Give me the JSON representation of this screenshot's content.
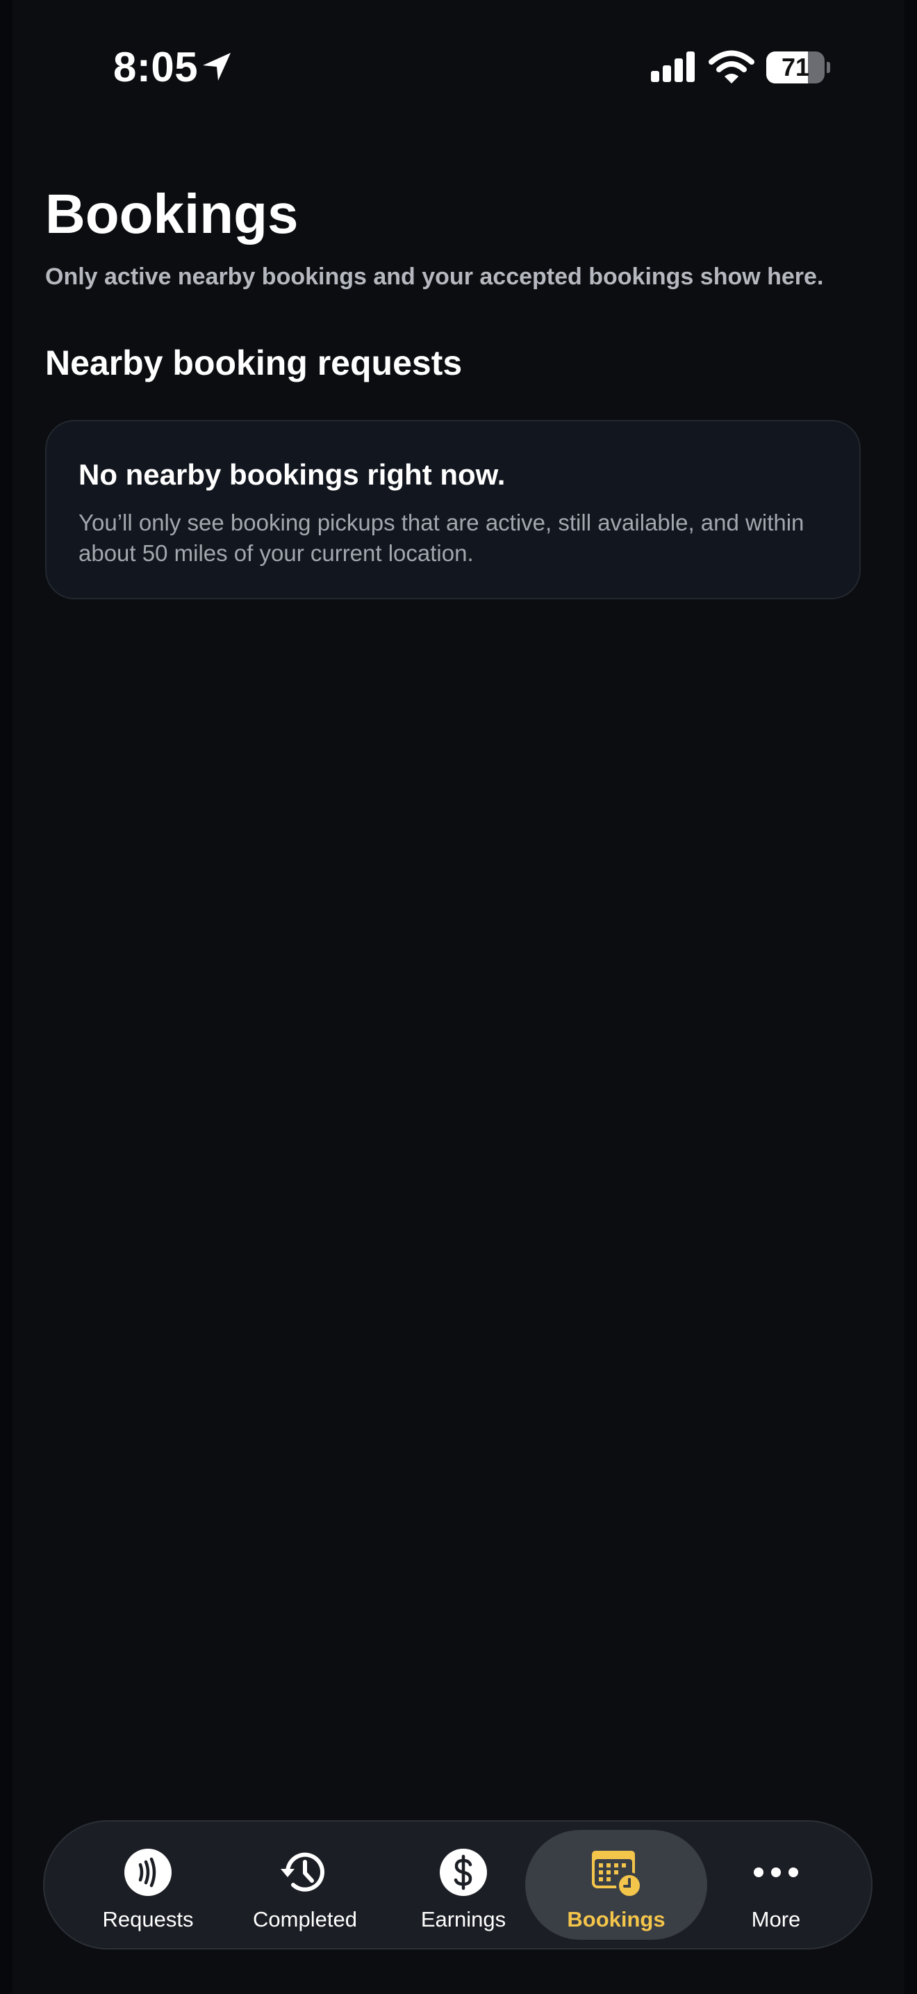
{
  "status_bar": {
    "time": "8:05",
    "battery_level": "71",
    "battery_fraction": 0.71
  },
  "header": {
    "title": "Bookings",
    "subtitle": "Only active nearby bookings and your accepted bookings show here."
  },
  "section": {
    "title": "Nearby booking requests"
  },
  "empty_state": {
    "title": "No nearby bookings right now.",
    "body": "You’ll only see booking pickups that are active, still available, and within about 50 miles of your current location."
  },
  "tab_bar": {
    "active_tab": "bookings",
    "tabs": [
      {
        "id": "requests",
        "label": "Requests",
        "icon": "contactless-icon"
      },
      {
        "id": "completed",
        "label": "Completed",
        "icon": "history-icon"
      },
      {
        "id": "earnings",
        "label": "Earnings",
        "icon": "dollar-icon"
      },
      {
        "id": "bookings",
        "label": "Bookings",
        "icon": "calendar-clock-icon"
      },
      {
        "id": "more",
        "label": "More",
        "icon": "more-dots-icon"
      }
    ]
  },
  "colors": {
    "background": "#0b0d11",
    "card_background": "#12161e",
    "accent": "#f4c54b",
    "muted_text": "#b5b8be",
    "tab_bar": "#1b1e24",
    "active_tab": "#3a3e45"
  }
}
